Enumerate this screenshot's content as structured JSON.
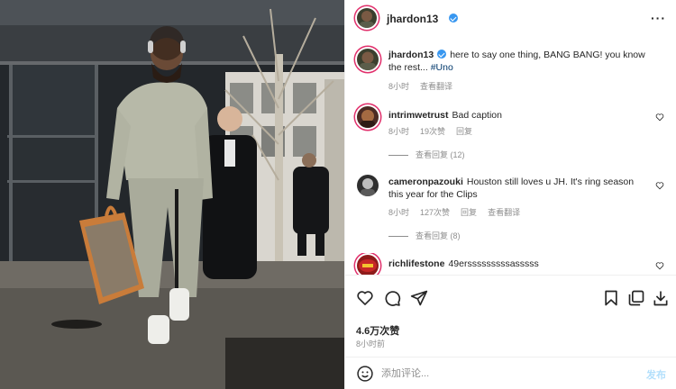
{
  "post": {
    "username": "jhardon13",
    "more_icon": "more-horizontal-icon",
    "caption_user": "jhardon13",
    "caption_text": "here to say one thing, BANG BANG! you know the rest...",
    "caption_hashtag": "#Uno",
    "caption_time": "8小时",
    "caption_translate": "查看翻译",
    "likes": "4.6万次赞",
    "posted_time": "8小时前"
  },
  "comments": [
    {
      "username": "intrimwetrust",
      "text": "Bad caption",
      "time": "8小时",
      "likes": "19次赞",
      "reply": "回复",
      "view_replies": "查看回复 (12)"
    },
    {
      "username": "cameronpazouki",
      "text": "Houston still loves u JH. It's ring season this year for the Clips",
      "time": "8小时",
      "likes": "127次赞",
      "reply": "回复",
      "translate": "查看翻译",
      "view_replies": "查看回复 (8)"
    },
    {
      "username": "richlifestone",
      "text": "49ersssssssssasssss"
    }
  ],
  "icons": {
    "like": "heart-icon",
    "comment": "comment-icon",
    "share": "send-icon",
    "save": "bookmark-icon",
    "collection": "collection-icon",
    "download": "download-icon",
    "emoji": "emoji-icon"
  },
  "add_comment": {
    "placeholder": "添加评论...",
    "post_label": "发布"
  },
  "colors": {
    "verified": "#3897f0",
    "link": "#00376b",
    "post_button_disabled": "#b2dffc",
    "muted_text": "#8e8e8e"
  }
}
